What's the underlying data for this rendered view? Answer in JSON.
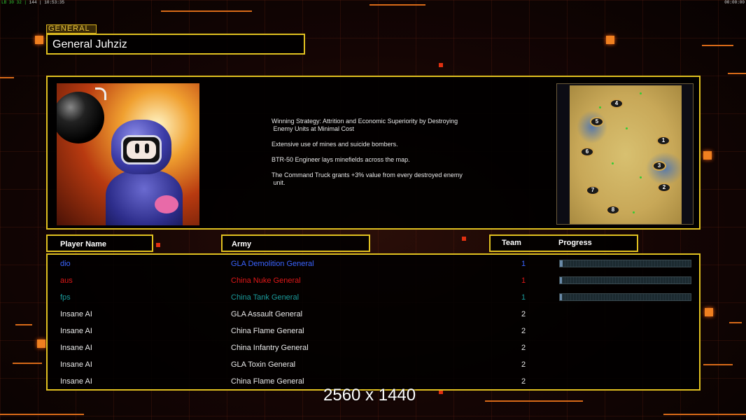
{
  "overlay": {
    "fps_left": "LB 30 32 |",
    "fps_mid": "144",
    "fps_right": "| 10:53:35",
    "clock_right": "00:00:00",
    "resolution_label": "2560 x 1440"
  },
  "general": {
    "tag": "GENERAL",
    "name": "General Juhziz"
  },
  "strategy": [
    "Winning Strategy: Attrition and Economic Superiority by Destroying\n Enemy Units at Minimal Cost",
    "Extensive use of mines and suicide bombers.",
    "BTR-50 Engineer lays minefields across the map.",
    "The Command Truck grants +3% value from every destroyed enemy\n unit."
  ],
  "minimap": {
    "spots": [
      "4",
      "5",
      "1",
      "6",
      "3",
      "2",
      "7",
      "8"
    ]
  },
  "headers": {
    "player_name": "Player Name",
    "army": "Army",
    "team": "Team",
    "progress": "Progress"
  },
  "players": [
    {
      "name": "dio",
      "army": "GLA Demolition General",
      "team": "1",
      "color": "#3a64ff",
      "progress": 0.02,
      "show_progress": true
    },
    {
      "name": "aus",
      "army": "China Nuke General",
      "team": "1",
      "color": "#e01818",
      "progress": 0.01,
      "show_progress": true
    },
    {
      "name": "fps",
      "army": "China Tank General",
      "team": "1",
      "color": "#1a9a9a",
      "progress": 0.01,
      "show_progress": true
    },
    {
      "name": "Insane AI",
      "army": "GLA Assault General",
      "team": "2",
      "color": "#e8e8e8",
      "progress": 0,
      "show_progress": false
    },
    {
      "name": "Insane AI",
      "army": "China Flame General",
      "team": "2",
      "color": "#e8e8e8",
      "progress": 0,
      "show_progress": false
    },
    {
      "name": "Insane AI",
      "army": "China Infantry General",
      "team": "2",
      "color": "#e8e8e8",
      "progress": 0,
      "show_progress": false
    },
    {
      "name": "Insane AI",
      "army": "GLA Toxin General",
      "team": "2",
      "color": "#e8e8e8",
      "progress": 0,
      "show_progress": false
    },
    {
      "name": "Insane AI",
      "army": "China Flame General",
      "team": "2",
      "color": "#e8e8e8",
      "progress": 0,
      "show_progress": false
    }
  ]
}
